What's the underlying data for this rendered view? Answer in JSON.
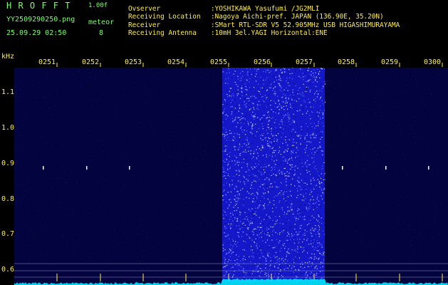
{
  "header": {
    "app_name": "H R O F F T",
    "version": "1.00f",
    "file_name": "YY2509290250.png",
    "datetime": "25.09.29 02:50",
    "meteor_label": "meteor",
    "meteor_count": "8",
    "info": [
      {
        "key": "Ovserver",
        "value": ":YOSHIKAWA Yasufumi /JG2MLI"
      },
      {
        "key": "Receiving Location",
        "value": ":Nagoya Aichi-pref. JAPAN (136.90E, 35.20N)"
      },
      {
        "key": "Receiver",
        "value": ":SMart RTL-SDR V5 52.905MHz USB HIGASHIMURAYAMA"
      },
      {
        "key": "Receiving Antenna",
        "value": ":10mH 3el.YAGI Horizontal:ENE"
      }
    ]
  },
  "axis": {
    "unit": "kHz",
    "y_ticks": [
      "1.1",
      "1.0",
      "0.9",
      "0.8",
      "0.7",
      "0.6"
    ],
    "time_ticks": [
      "0251",
      "0252",
      "0253",
      "0254",
      "0255",
      "0256",
      "0257",
      "0258",
      "0259",
      "0300"
    ]
  },
  "colors": {
    "background": "#000000",
    "spectrogram_bg": "#02033f",
    "noise_band": "#1418c8",
    "header_left": "#7dff6e",
    "header_right": "#ffee55",
    "signal_trace": "#00e8ff"
  },
  "observation": {
    "noise_band_minutes": [
      "0255",
      "0257"
    ],
    "meteor_echo_minutes": [
      "0251",
      "0252",
      "0253",
      "0258",
      "0259",
      "0300"
    ]
  }
}
